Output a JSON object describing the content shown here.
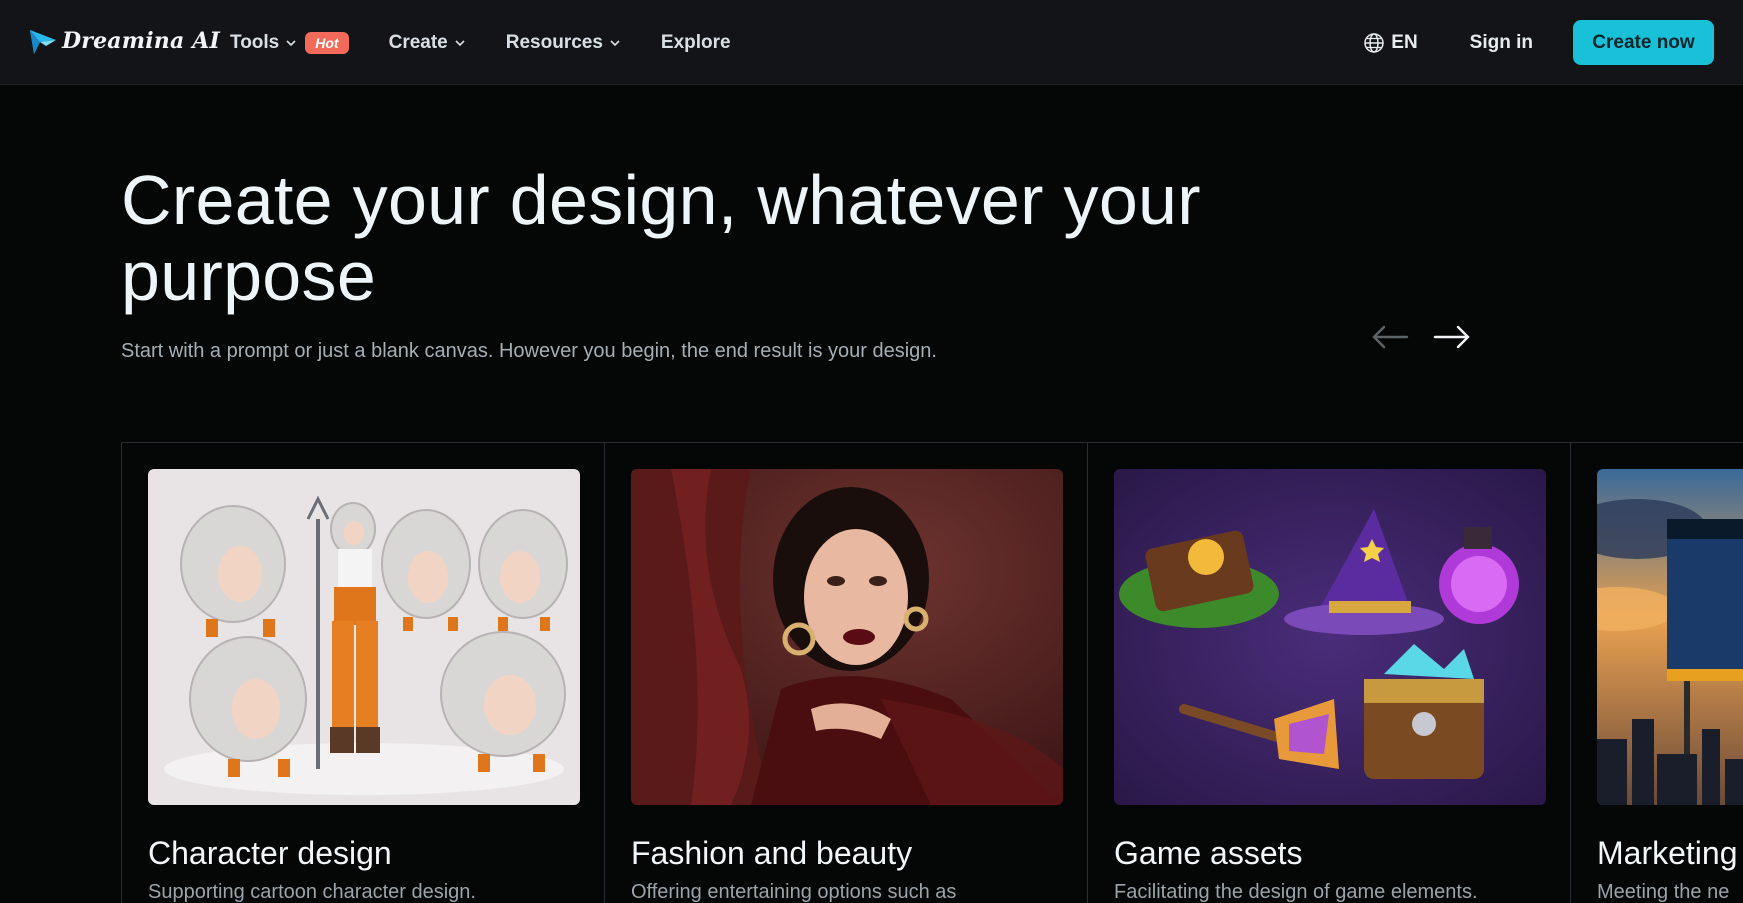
{
  "header": {
    "logo_text": "Dreamina AI",
    "nav": [
      {
        "label": "Tools",
        "badge": "Hot"
      },
      {
        "label": "Create"
      },
      {
        "label": "Resources"
      },
      {
        "label": "Explore"
      }
    ],
    "language": "EN",
    "sign_in": "Sign in",
    "create_now": "Create now"
  },
  "hero": {
    "title": "Create your design, whatever your purpose",
    "subtitle": "Start with a prompt or just a blank canvas. However you begin, the end result is your design."
  },
  "cards": [
    {
      "title": "Character design",
      "description": "Supporting cartoon character design."
    },
    {
      "title": "Fashion and beauty",
      "description": "Offering entertaining options such as"
    },
    {
      "title": "Game assets",
      "description": "Facilitating the design of game elements."
    },
    {
      "title": "Marketing",
      "description": "Meeting the ne"
    }
  ],
  "colors": {
    "accent": "#19c1d8",
    "hot_badge": "#f26b5a",
    "background": "#050606",
    "header_bg": "#121417"
  }
}
